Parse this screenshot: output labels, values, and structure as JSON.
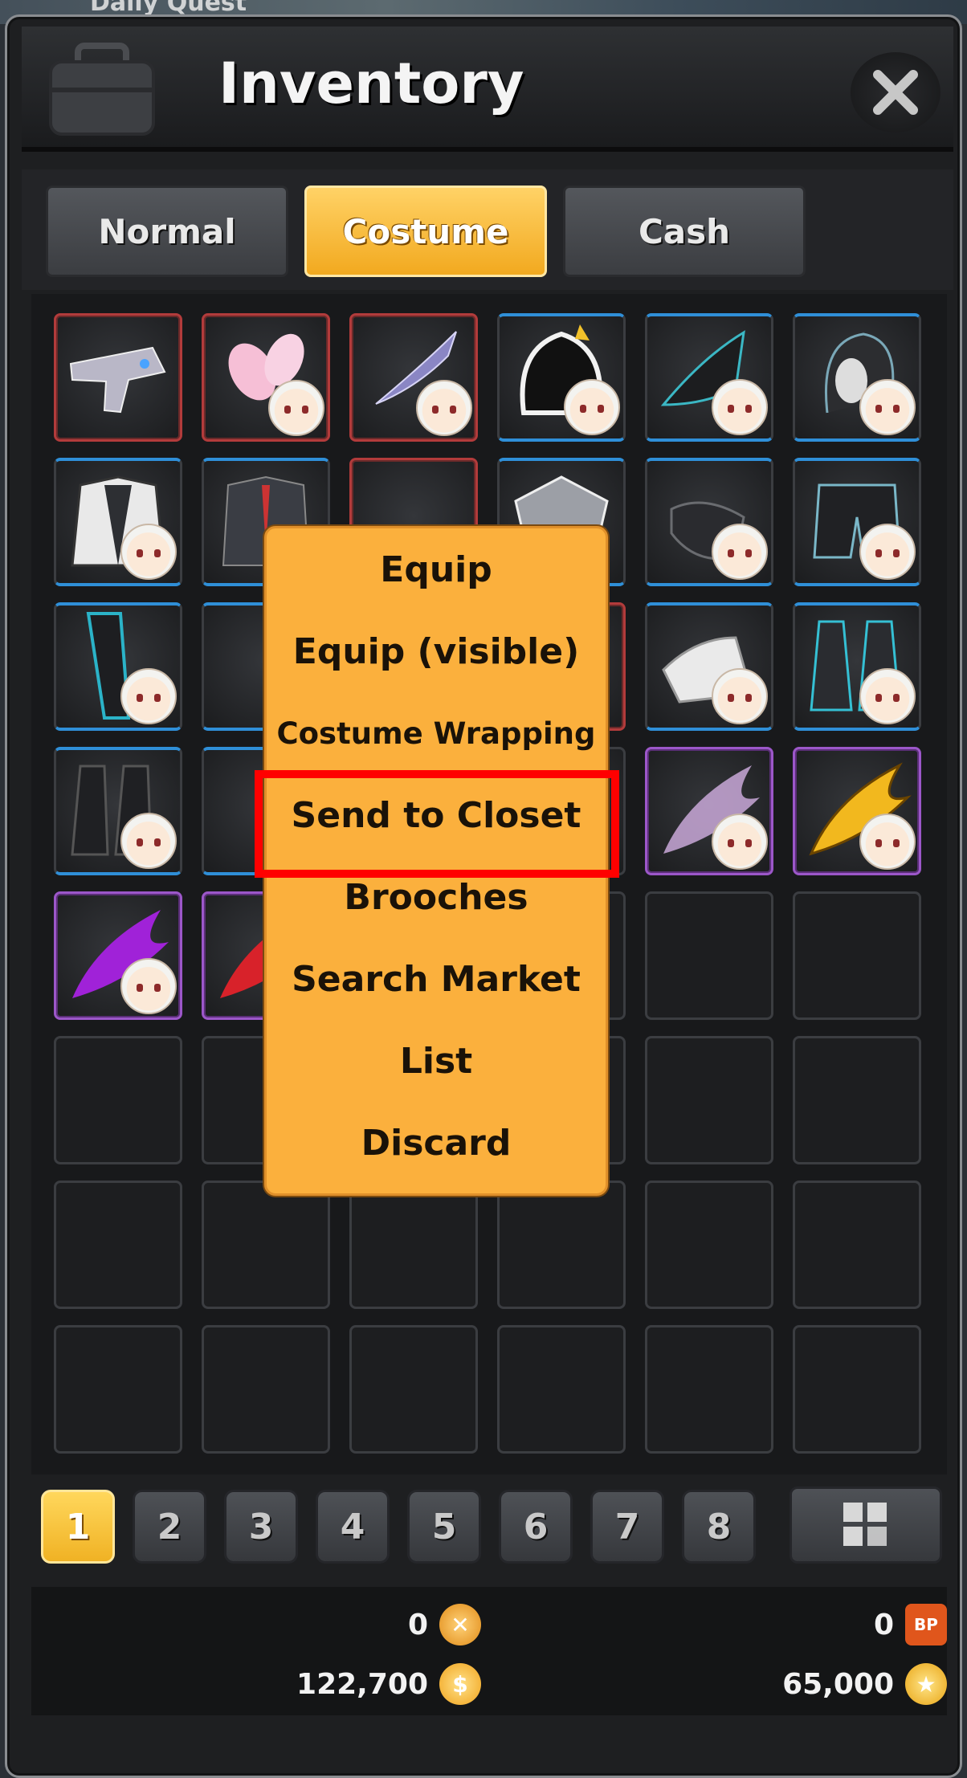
{
  "background": {
    "label": "Daily Quest"
  },
  "window": {
    "title": "Inventory"
  },
  "tabs": [
    {
      "label": "Normal",
      "active": false
    },
    {
      "label": "Costume",
      "active": true
    },
    {
      "label": "Cash",
      "active": false
    }
  ],
  "context_menu": {
    "items": [
      {
        "label": "Equip"
      },
      {
        "label": "Equip (visible)"
      },
      {
        "label": "Costume Wrapping"
      },
      {
        "label": "Send to Closet",
        "highlighted": true
      },
      {
        "label": "Brooches"
      },
      {
        "label": "Search Market"
      },
      {
        "label": "List"
      },
      {
        "label": "Discard"
      }
    ]
  },
  "pages": [
    "1",
    "2",
    "3",
    "4",
    "5",
    "6",
    "7",
    "8"
  ],
  "active_page": "1",
  "currency": {
    "top_left_value": "0",
    "top_right_value": "0",
    "bottom_left_value": "122,700",
    "bottom_right_value": "65,000",
    "bp_label": "BP"
  },
  "colors": {
    "accent": "#fbb03d",
    "highlight_box": "#ff0000",
    "rarity_red": "#b23b3b",
    "rarity_blue": "#2f8fd8",
    "rarity_purple": "#9c57c9"
  }
}
